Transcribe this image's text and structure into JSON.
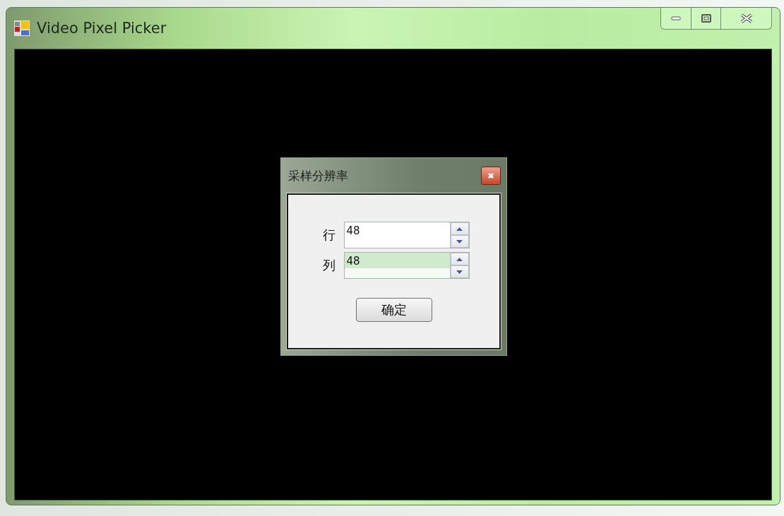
{
  "window": {
    "title": "Video Pixel Picker"
  },
  "dialog": {
    "title": "采样分辨率",
    "fields": [
      {
        "label": "行",
        "value": "48",
        "focused": false
      },
      {
        "label": "列",
        "value": "48",
        "focused": true
      }
    ],
    "ok_button": "确定"
  }
}
